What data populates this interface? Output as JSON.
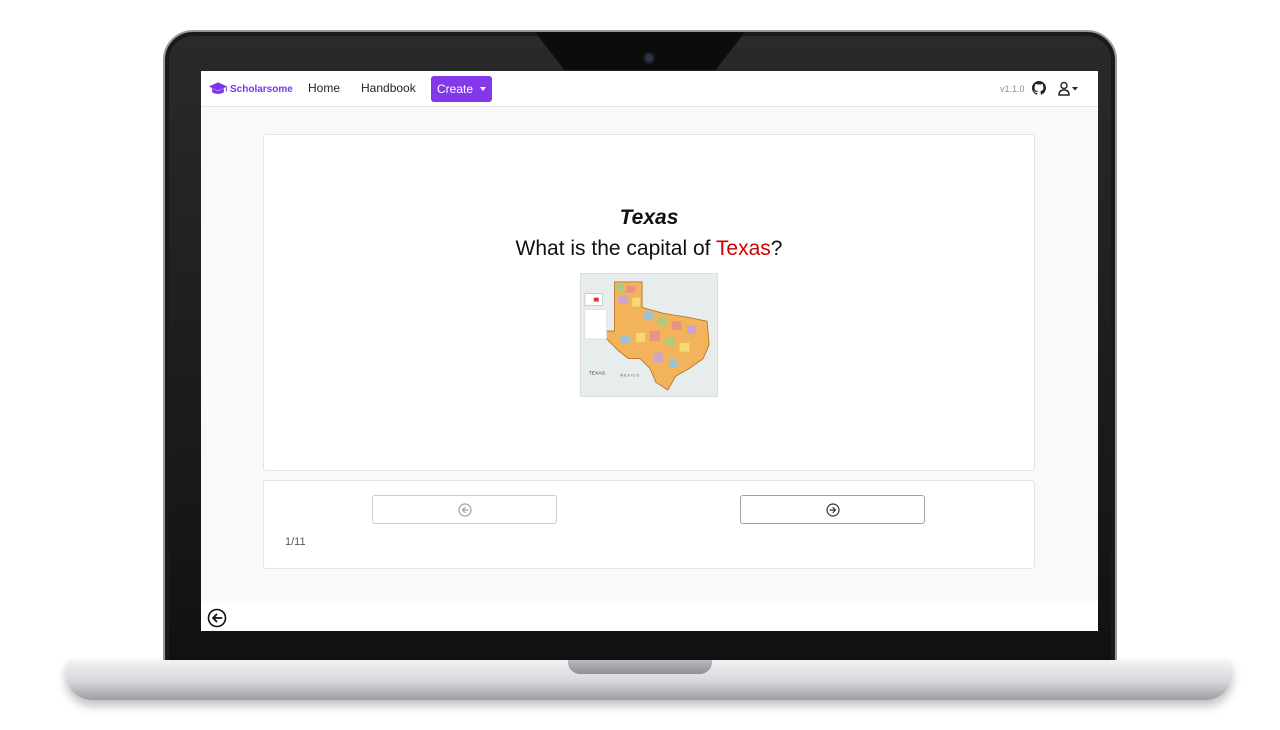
{
  "navbar": {
    "brand": "Scholarsome",
    "links": {
      "home": "Home",
      "handbook": "Handbook"
    },
    "create_label": "Create",
    "version": "v1.1.0",
    "icons": {
      "github": "github-icon",
      "user": "user-icon",
      "brand": "graduation-cap-icon"
    }
  },
  "question": {
    "title": "Texas",
    "prompt_before": "What is the capital of ",
    "prompt_highlight": "Texas",
    "prompt_after": "?",
    "highlight_color": "#d10000",
    "image": "texas-counties-map"
  },
  "navigation": {
    "prev_icon": "arrow-left-circle-icon",
    "next_icon": "arrow-right-circle-icon",
    "counter": "1/11"
  },
  "footer": {
    "back_icon": "arrow-left-circle-icon"
  },
  "colors": {
    "accent": "#8338ec",
    "brand": "#7a35f0"
  }
}
